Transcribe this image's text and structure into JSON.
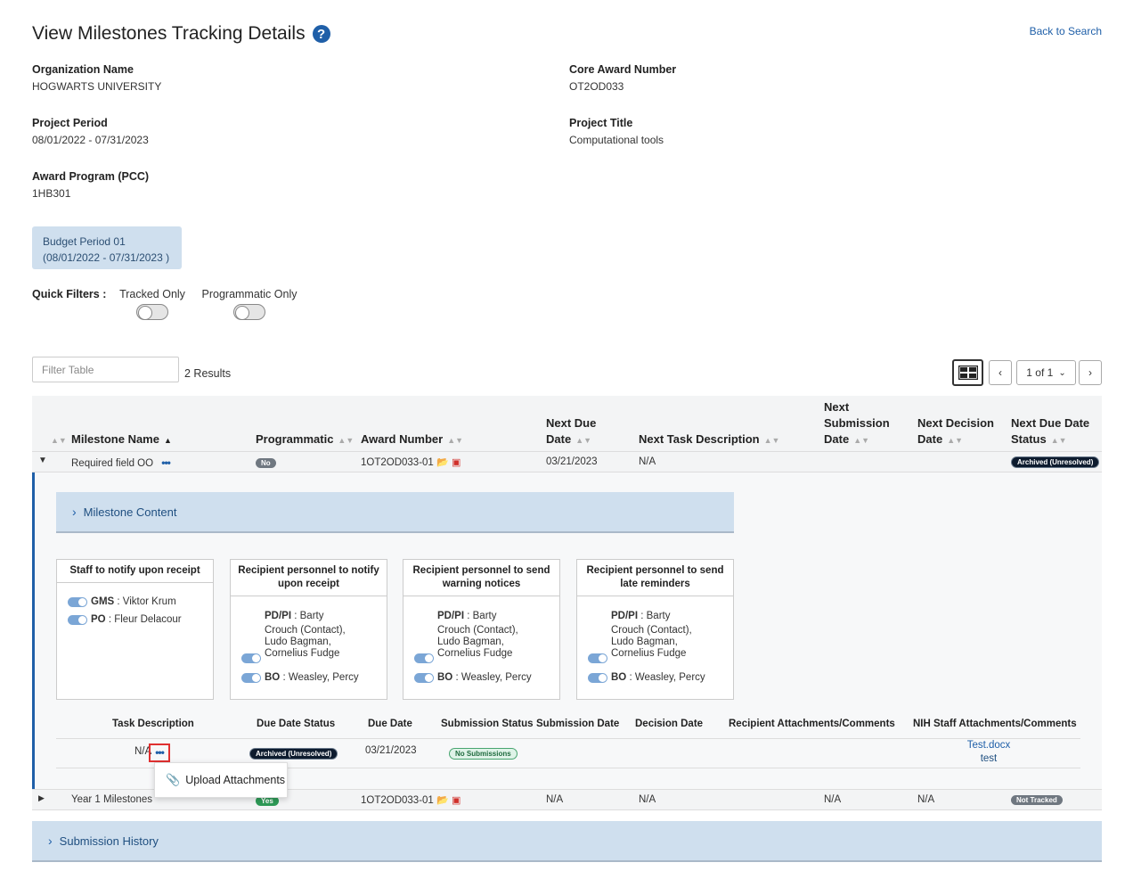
{
  "page": {
    "title": "View Milestones Tracking Details",
    "back_link": "Back to Search"
  },
  "details": {
    "org_label": "Organization Name",
    "org_value": "HOGWARTS UNIVERSITY",
    "core_label": "Core Award Number",
    "core_value": "OT2OD033",
    "period_label": "Project Period",
    "period_value": "08/01/2022 - 07/31/2023",
    "ptitle_label": "Project Title",
    "ptitle_value": "Computational tools",
    "program_label": "Award Program (PCC)",
    "program_value": "1HB301"
  },
  "budget_period": {
    "line1": "Budget Period 01",
    "line2": "(08/01/2022 - 07/31/2023 )"
  },
  "quick_filters": {
    "label": "Quick Filters :",
    "tracked_only": "Tracked Only",
    "programmatic_only": "Programmatic Only"
  },
  "table_controls": {
    "filter_placeholder": "Filter Table",
    "results": "2 Results",
    "page_select": "1 of 1"
  },
  "table": {
    "headers": {
      "milestone_name": "Milestone Name",
      "programmatic": "Programmatic",
      "award_number": "Award Number",
      "next_due_date_1": "Next Due",
      "next_due_date_2": "Date",
      "next_task": "Next Task Description",
      "next_sub_1": "Next",
      "next_sub_2": "Submission",
      "next_sub_3": "Date",
      "next_dec_1": "Next Decision",
      "next_dec_2": "Date",
      "next_status_1": "Next Due Date",
      "next_status_2": "Status"
    },
    "rows": [
      {
        "milestone_name": "Required field OO",
        "programmatic": "No",
        "award_number": "1OT2OD033-01",
        "next_due_date": "03/21/2023",
        "next_task": "N/A",
        "next_sub_date": "",
        "next_dec_date": "",
        "status": "Archived (Unresolved)"
      },
      {
        "milestone_name": "Year 1 Milestones",
        "programmatic": "Yes",
        "award_number": "1OT2OD033-01",
        "next_due_date": "N/A",
        "next_task": "N/A",
        "next_sub_date": "N/A",
        "next_dec_date": "N/A",
        "status": "Not Tracked"
      }
    ]
  },
  "expanded": {
    "milestone_content": "Milestone Content",
    "cards": [
      {
        "title_1": "Staff to notify upon receipt",
        "title_2": "",
        "gms_label": "GMS",
        "gms_value": " : Viktor Krum",
        "po_label": "PO",
        "po_value": " : Fleur Delacour"
      },
      {
        "title_1": "Recipient personnel to notify",
        "title_2": "upon receipt",
        "pdpi_label": "PD/PI",
        "pdpi_line1": " : Barty",
        "pdpi_line2": "Crouch (Contact),",
        "pdpi_line3": "Ludo Bagman,",
        "pdpi_line4": "Cornelius Fudge",
        "bo_label": "BO",
        "bo_value": " : Weasley, Percy"
      },
      {
        "title_1": "Recipient personnel to send",
        "title_2": "warning notices",
        "pdpi_label": "PD/PI",
        "pdpi_line1": " : Barty",
        "pdpi_line2": "Crouch (Contact),",
        "pdpi_line3": "Ludo Bagman,",
        "pdpi_line4": "Cornelius Fudge",
        "bo_label": "BO",
        "bo_value": " : Weasley, Percy"
      },
      {
        "title_1": "Recipient personnel to send",
        "title_2": "late reminders",
        "pdpi_label": "PD/PI",
        "pdpi_line1": " : Barty",
        "pdpi_line2": "Crouch (Contact),",
        "pdpi_line3": "Ludo Bagman,",
        "pdpi_line4": "Cornelius Fudge",
        "bo_label": "BO",
        "bo_value": " : Weasley, Percy"
      }
    ],
    "sub_headers": {
      "task_desc": "Task Description",
      "due_status": "Due Date Status",
      "due_date": "Due Date",
      "sub_status": "Submission Status",
      "sub_date": "Submission Date",
      "dec_date": "Decision Date",
      "recip_att": "Recipient Attachments/Comments",
      "nih_att": "NIH Staff Attachments/Comments"
    },
    "sub_row": {
      "task_desc": "N/A",
      "due_status": "Archived (Unresolved)",
      "due_date": "03/21/2023",
      "sub_status": "No Submissions",
      "nih_file": "Test.docx",
      "nih_comment": "test"
    },
    "menu": {
      "upload": "Upload Attachments"
    }
  },
  "submission_history": "Submission History",
  "colors": {
    "accent": "#1f5fa8",
    "panel": "#cfdfee",
    "dark_badge": "#0d1b2e"
  }
}
